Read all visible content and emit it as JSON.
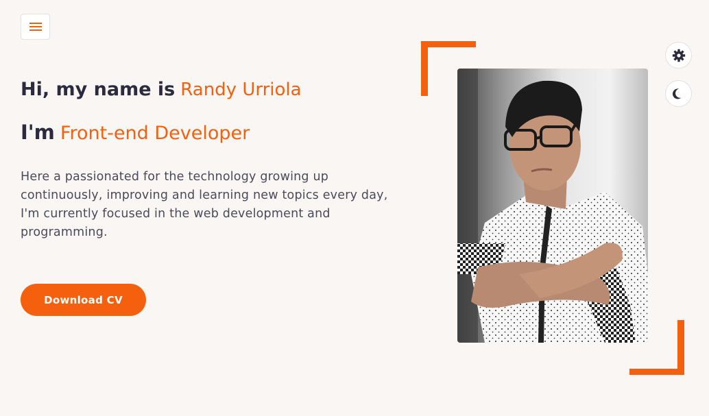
{
  "hero": {
    "greeting": "Hi, my name is",
    "name": "Randy Urriola",
    "role_prefix": "I'm",
    "role": "Front-end Developer",
    "bio": "Here a passionated for the technology growing up continuously, improving and learning new topics every day, I'm currently focused in the web development and programming.",
    "cta_label": "Download CV"
  },
  "icons": {
    "menu": "hamburger-menu-icon",
    "settings": "gear-icon",
    "theme": "moon-icon"
  },
  "colors": {
    "accent": "#f5600e",
    "text_dark": "#2b2b3f",
    "text_body": "#4a4a5a",
    "background": "#f9f6f3"
  }
}
